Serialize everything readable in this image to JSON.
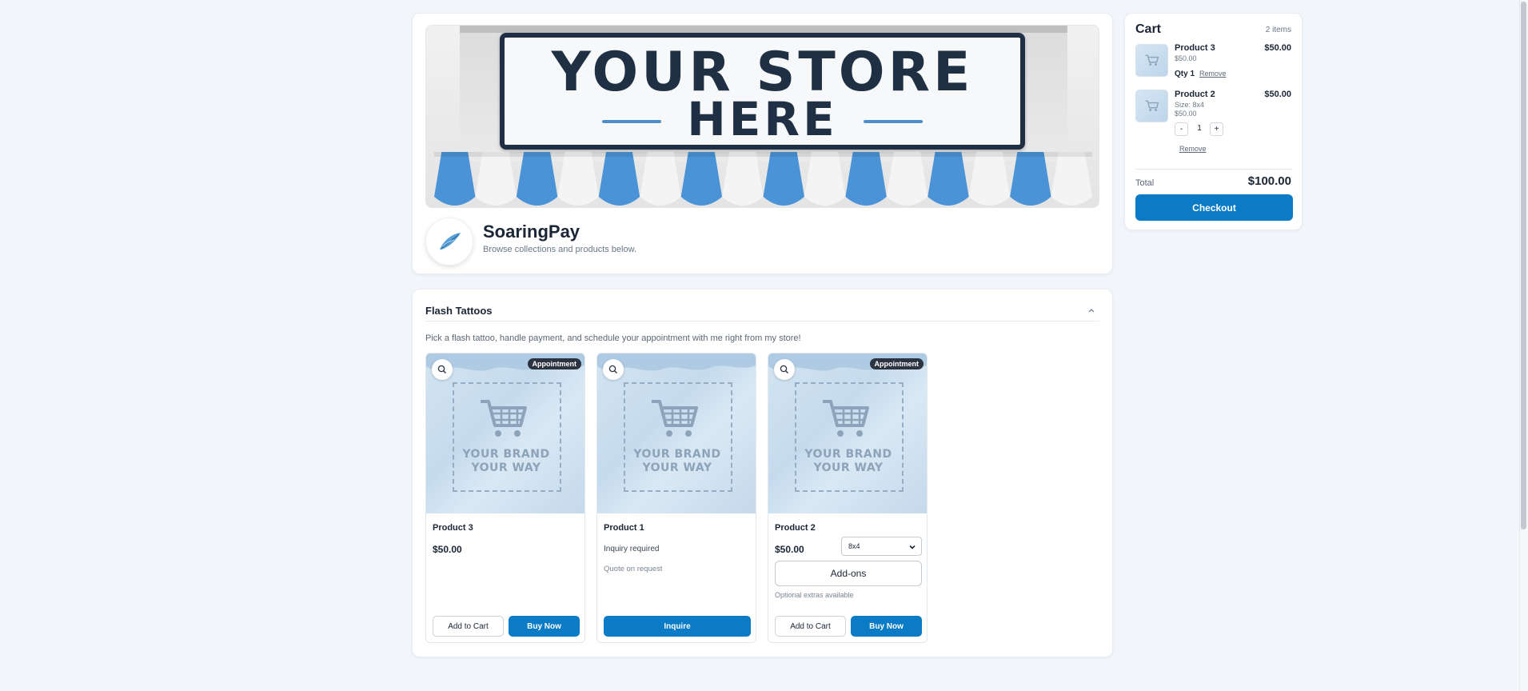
{
  "banner": {
    "line1": "YOUR STORE",
    "line2": "HERE",
    "awning_colors": [
      "#4a93d6",
      "#f4f4f4"
    ]
  },
  "store": {
    "name": "SoaringPay",
    "tagline": "Browse collections and products below."
  },
  "collection": {
    "title": "Flash Tattoos",
    "description": "Pick a flash tattoo, handle payment, and schedule your appointment with me right from my store!",
    "placeholder_text": [
      "YOUR BRAND",
      "YOUR WAY"
    ],
    "products": [
      {
        "name": "Product 3",
        "badge": "Appointment",
        "price": "$50.00",
        "add_to_cart": "Add to Cart",
        "buy_now": "Buy Now"
      },
      {
        "name": "Product 1",
        "inquiry": "Inquiry required",
        "quote": "Quote on request",
        "inquire": "Inquire"
      },
      {
        "name": "Product 2",
        "badge": "Appointment",
        "price": "$50.00",
        "size_selected": "8x4",
        "addons": "Add-ons",
        "addons_note": "Optional extras available",
        "add_to_cart": "Add to Cart",
        "buy_now": "Buy Now"
      }
    ]
  },
  "cart": {
    "title": "Cart",
    "count": "2 items",
    "items": [
      {
        "name": "Product 3",
        "unit_price": "$50.00",
        "line_price": "$50.00",
        "qty_label": "Qty 1",
        "remove": "Remove"
      },
      {
        "name": "Product 2",
        "size": "Size: 8x4",
        "unit_price": "$50.00",
        "line_price": "$50.00",
        "minus": "-",
        "qty": "1",
        "plus": "+",
        "remove": "Remove"
      }
    ],
    "total_label": "Total",
    "total_value": "$100.00",
    "checkout": "Checkout"
  },
  "colors": {
    "accent": "#0a7bc4",
    "badge": "#2b3440",
    "banner_sign": "#1f3045"
  },
  "icons": [
    "search-icon",
    "chevron-up-icon",
    "shopping-cart-icon",
    "feather-logo-icon",
    "dropdown-caret-icon"
  ]
}
